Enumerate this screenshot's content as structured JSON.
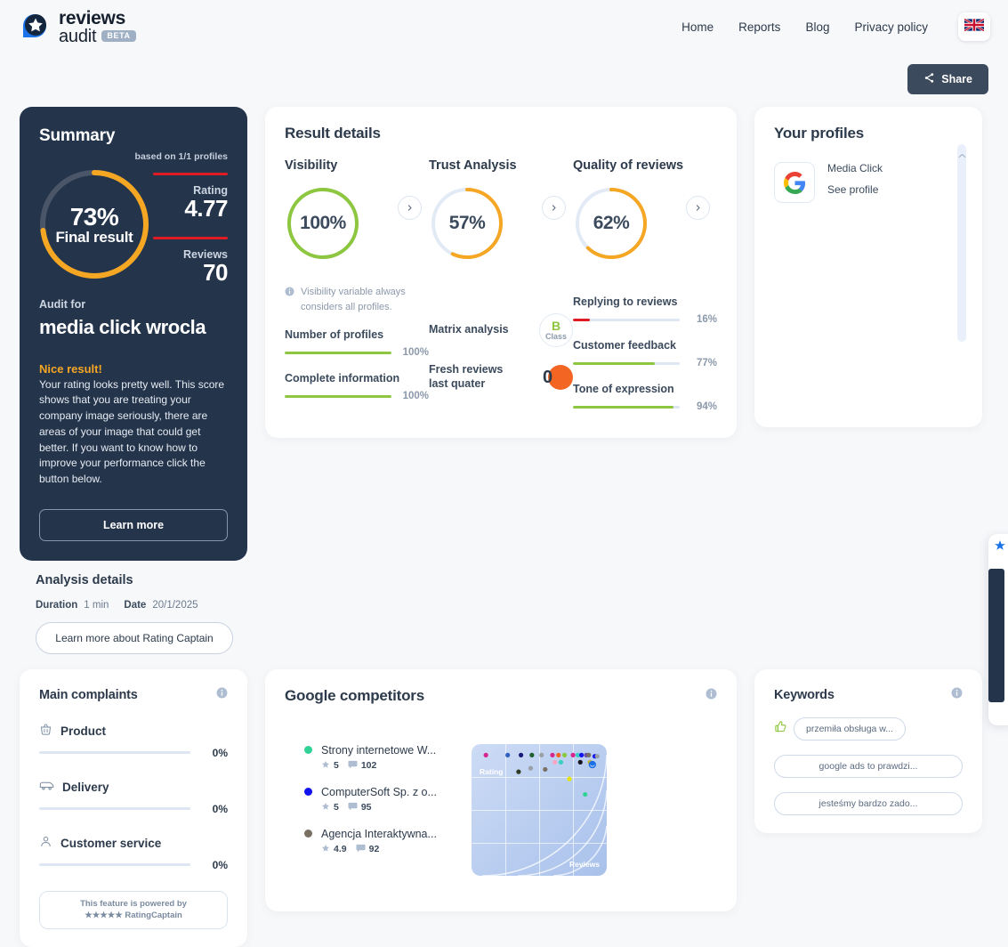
{
  "brand": {
    "line1": "reviews",
    "line2": "audit",
    "badge": "BETA",
    "logo_icon": "reviews-audit-logo-icon"
  },
  "nav": {
    "items": [
      {
        "label": "Home"
      },
      {
        "label": "Reports"
      },
      {
        "label": "Blog"
      },
      {
        "label": "Privacy policy"
      }
    ],
    "language_flag": "uk-flag-icon"
  },
  "toolbar": {
    "share_label": "Share",
    "share_icon": "share-icon"
  },
  "summary": {
    "title": "Summary",
    "based_on": "based on 1/1 profiles",
    "final_percent": "73%",
    "final_caption": "Final result",
    "final_value": 73,
    "rating_label": "Rating",
    "rating_value": "4.77",
    "reviews_label": "Reviews",
    "reviews_value": "70",
    "audit_for_label": "Audit for",
    "audit_for_name": "media click wrocla",
    "verdict_title": "Nice result!",
    "verdict_body": "Your rating looks pretty well. This score shows that you are treating your company image seriously, there are areas of your image that could get better. If you want to know how to improve your performance click the button below.",
    "learn_more_label": "Learn more",
    "accent_color": "#f5a623",
    "track_color": "#4a5568"
  },
  "analysis": {
    "title": "Analysis details",
    "duration_label": "Duration",
    "duration_value": "1 min",
    "date_label": "Date",
    "date_value": "20/1/2025",
    "button_label": "Learn more about Rating Captain"
  },
  "result_details": {
    "title": "Result details",
    "columns": [
      {
        "heading": "Visibility",
        "percent": "100%",
        "value": 100,
        "ring_color": "#8dc63f",
        "note": "Visibility variable always considers all profiles.",
        "note_icon": "info-icon",
        "chevron_icon": "chevron-right-icon",
        "metrics": [
          {
            "label": "Number of profiles",
            "value": "100%",
            "pct": 100,
            "color": "#8dc63f"
          },
          {
            "label": "Complete information",
            "value": "100%",
            "pct": 100,
            "color": "#8dc63f"
          }
        ]
      },
      {
        "heading": "Trust Analysis",
        "percent": "57%",
        "value": 57,
        "ring_color": "#f5a623",
        "chevron_icon": "chevron-right-icon",
        "matrix_label": "Matrix analysis",
        "matrix_grade": "B",
        "matrix_grade_caption": "Class",
        "fresh_label": "Fresh reviews last quater",
        "fresh_value": "0"
      },
      {
        "heading": "Quality of reviews",
        "percent": "62%",
        "value": 62,
        "ring_color": "#f5a623",
        "chevron_icon": "chevron-right-icon",
        "metrics": [
          {
            "label": "Replying to reviews",
            "value": "16%",
            "pct": 16,
            "color": "#e01b24"
          },
          {
            "label": "Customer feedback",
            "value": "77%",
            "pct": 77,
            "color": "#8dc63f"
          },
          {
            "label": "Tone of expression",
            "value": "94%",
            "pct": 94,
            "color": "#8dc63f"
          }
        ]
      }
    ]
  },
  "profiles": {
    "title": "Your profiles",
    "items": [
      {
        "icon": "google-icon",
        "name": "Media Click",
        "link_label": "See profile"
      }
    ],
    "scroll_icon": "chevron-up-icon"
  },
  "complaints": {
    "title": "Main complaints",
    "info_icon": "info-icon",
    "items": [
      {
        "icon": "basket-icon",
        "label": "Product",
        "value": "0%",
        "pct": 0
      },
      {
        "icon": "truck-icon",
        "label": "Delivery",
        "value": "0%",
        "pct": 0
      },
      {
        "icon": "person-icon",
        "label": "Customer service",
        "value": "0%",
        "pct": 0
      }
    ],
    "powered_line1": "This feature is powered by",
    "powered_line2": "★★★★★ RatingCaptain"
  },
  "competitors": {
    "title": "Google competitors",
    "info_icon": "info-icon",
    "items": [
      {
        "color": "#32d296",
        "name": "Strony internetowe W...",
        "rating": "5",
        "reviews": "102",
        "star_icon": "star-icon",
        "comment_icon": "comment-icon"
      },
      {
        "color": "#1212ee",
        "name": "ComputerSoft Sp. z o...",
        "rating": "5",
        "reviews": "95",
        "star_icon": "star-icon",
        "comment_icon": "comment-icon"
      },
      {
        "color": "#7a6f63",
        "name": "Agencja Interaktywna...",
        "rating": "4.9",
        "reviews": "92",
        "star_icon": "star-icon",
        "comment_icon": "comment-icon"
      }
    ],
    "axis_y": "Rating",
    "axis_x": "Reviews"
  },
  "keywords": {
    "title": "Keywords",
    "info_icon": "info-icon",
    "thumb_icon": "thumbs-up-icon",
    "items": [
      {
        "label": "przemiła obsługa w..."
      },
      {
        "label": "google ads to prawdzi..."
      },
      {
        "label": "jesteśmy bardzo zado..."
      }
    ]
  },
  "chart_data": {
    "type": "scatter",
    "title": "Google competitors",
    "xlabel": "Reviews",
    "ylabel": "Rating",
    "grid": true,
    "points": [
      {
        "x": 6,
        "y": 96,
        "color": "#d6268f"
      },
      {
        "x": 24,
        "y": 96,
        "color": "#3060c0"
      },
      {
        "x": 35,
        "y": 96,
        "color": "#1a1a7a"
      },
      {
        "x": 44,
        "y": 96,
        "color": "#1f5f2e"
      },
      {
        "x": 52,
        "y": 96,
        "color": "#9aa0a6"
      },
      {
        "x": 61,
        "y": 96,
        "color": "#d6268f"
      },
      {
        "x": 66,
        "y": 96,
        "color": "#f26522"
      },
      {
        "x": 71,
        "y": 96,
        "color": "#8dc63f"
      },
      {
        "x": 78,
        "y": 96,
        "color": "#d6268f"
      },
      {
        "x": 82,
        "y": 96,
        "color": "#3ad1c0"
      },
      {
        "x": 85,
        "y": 96,
        "color": "#1212ee"
      },
      {
        "x": 89,
        "y": 96,
        "color": "#6b4fa0"
      },
      {
        "x": 91,
        "y": 96,
        "color": "#7a6f63"
      },
      {
        "x": 96,
        "y": 95,
        "color": "#1212ee"
      },
      {
        "x": 98,
        "y": 95,
        "color": "#9aa0a6"
      },
      {
        "x": 63,
        "y": 90,
        "color": "#f7a6c4"
      },
      {
        "x": 68,
        "y": 90,
        "color": "#3ad1c0"
      },
      {
        "x": 84,
        "y": 90,
        "color": "#15151f"
      },
      {
        "x": 92,
        "y": 90,
        "color": "#c9b037"
      },
      {
        "x": 94,
        "y": 89,
        "color": "#1a6fe8"
      },
      {
        "x": 43,
        "y": 85,
        "color": "#9aa0a6"
      },
      {
        "x": 55,
        "y": 84,
        "color": "#7a6f63"
      },
      {
        "x": 33,
        "y": 82,
        "color": "#2e3b22"
      },
      {
        "x": 75,
        "y": 76,
        "color": "#e3e30d"
      },
      {
        "x": 88,
        "y": 63,
        "color": "#32d296"
      }
    ]
  }
}
